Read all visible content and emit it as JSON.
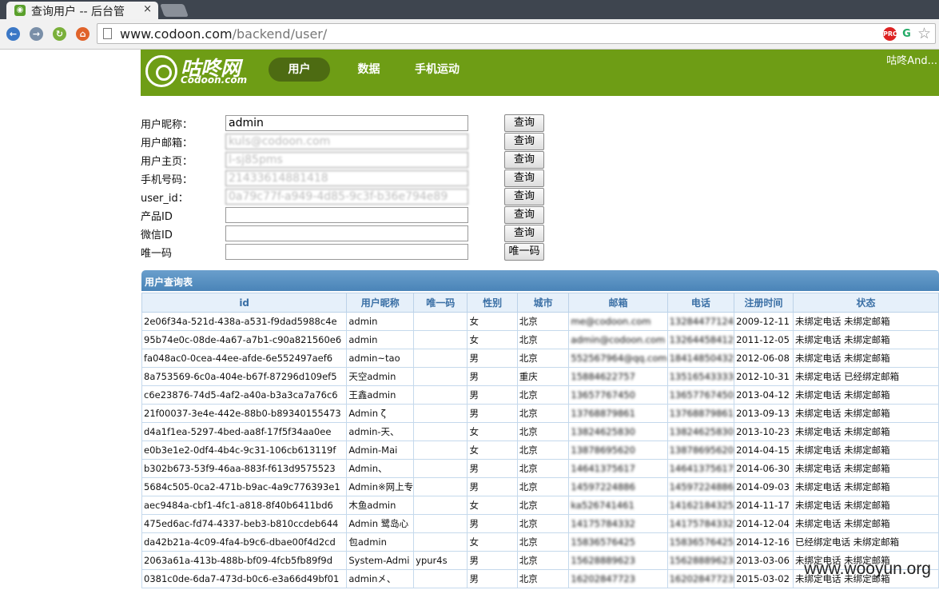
{
  "browser": {
    "tab_title": "查询用户 -- 后台管",
    "tab_close": "×",
    "url_host": "www.codoon.com",
    "url_path": "/backend/user/"
  },
  "site": {
    "logo_cn": "咕咚网",
    "logo_en": "Codoon.com",
    "nav": [
      {
        "label": "用户",
        "active": true
      },
      {
        "label": "数据",
        "active": false
      },
      {
        "label": "手机运动",
        "active": false
      }
    ],
    "account": "咕咚And..."
  },
  "search_form": {
    "rows": [
      {
        "label": "用户昵称：",
        "value": "admin",
        "button": "查询"
      },
      {
        "label": "用户邮箱：",
        "value": "kuls@codoon.com",
        "button": "查询"
      },
      {
        "label": "用户主页：",
        "value": "l-sj85pms",
        "button": "查询"
      },
      {
        "label": "手机号码：",
        "value": "21433614881418",
        "button": "查询"
      },
      {
        "label": "user_id：",
        "value": "0a79c77f-a949-4d85-9c3f-b36e794e89",
        "button": "查询"
      },
      {
        "label": "产品ID",
        "value": "",
        "button": "查询"
      },
      {
        "label": "微信ID",
        "value": "",
        "button": "查询"
      },
      {
        "label": "唯一码",
        "value": "",
        "button": "唯一码"
      }
    ]
  },
  "results": {
    "title": "用户查询表",
    "columns": [
      "id",
      "用户昵称",
      "唯一码",
      "性别",
      "城市",
      "邮箱",
      "电话",
      "注册时间",
      "状态"
    ],
    "rows": [
      [
        "2e06f34a-521d-438a-a531-f9dad5988c4e",
        "admin",
        "",
        "女",
        "北京",
        "me@codoon.com",
        "13284477124",
        "2009-12-11",
        "未绑定电话 未绑定邮箱"
      ],
      [
        "95b74e0c-08de-4a67-a7b1-c90a821560e6",
        "admin",
        "",
        "女",
        "北京",
        "admin@codoon.com",
        "13264458412",
        "2011-12-05",
        "未绑定电话 未绑定邮箱"
      ],
      [
        "fa048ac0-0cea-44ee-afde-6e552497aef6",
        "admin~tao",
        "",
        "男",
        "北京",
        "552567964@qq.com",
        "18414850432",
        "2012-06-08",
        "未绑定电话 未绑定邮箱"
      ],
      [
        "8a753569-6c0a-404e-b67f-87296d109ef5",
        "天空admin",
        "",
        "男",
        "重庆",
        "15884622757",
        "13516543333",
        "2012-10-31",
        "未绑定电话 已经绑定邮箱"
      ],
      [
        "c6e23876-74d5-4af2-a40a-b3a3ca7a76c6",
        "王鑫admin",
        "",
        "男",
        "北京",
        "13657767450",
        "13657767450",
        "2013-04-12",
        "未绑定电话 未绑定邮箱"
      ],
      [
        "21f00037-3e4e-442e-88b0-b89340155473",
        "Admin ζ",
        "",
        "男",
        "北京",
        "13768879861",
        "13768879861",
        "2013-09-13",
        "未绑定电话 未绑定邮箱"
      ],
      [
        "d4a1f1ea-5297-4bed-aa8f-17f5f34aa0ee",
        "admin-天、",
        "",
        "女",
        "北京",
        "13824625830",
        "13824625830",
        "2013-10-23",
        "未绑定电话 未绑定邮箱"
      ],
      [
        "e0b3e1e2-0df4-4b4c-9c31-106cb613119f",
        "Admin-Mai",
        "",
        "女",
        "北京",
        "13878695620",
        "13878695620",
        "2014-04-15",
        "未绑定电话 未绑定邮箱"
      ],
      [
        "b302b673-53f9-46aa-883f-f613d9575523",
        "Admin、",
        "",
        "男",
        "北京",
        "14641375617",
        "14641375617",
        "2014-06-30",
        "未绑定电话 未绑定邮箱"
      ],
      [
        "5684c505-0ca2-471b-b9ac-4a9c776393e1",
        "Admin※网上专",
        "",
        "男",
        "北京",
        "14597224886",
        "14597224886",
        "2014-09-03",
        "未绑定电话 未绑定邮箱"
      ],
      [
        "aec9484a-cbf1-4fc1-a818-8f40b6411bd6",
        "木鱼admin",
        "",
        "女",
        "北京",
        "ka526741461",
        "14162184325",
        "2014-11-17",
        "未绑定电话 未绑定邮箱"
      ],
      [
        "475ed6ac-fd74-4337-beb3-b810ccdeb644",
        "Admin 鹭岛心",
        "",
        "男",
        "北京",
        "14175784332",
        "14175784332",
        "2014-12-04",
        "未绑定电话 未绑定邮箱"
      ],
      [
        "da42b21a-4c09-4fa4-b9c6-dbae00f4d2cd",
        "包admin",
        "",
        "女",
        "北京",
        "15836576425",
        "15836576425",
        "2014-12-16",
        "已经绑定电话 未绑定邮箱"
      ],
      [
        "2063a61a-413b-488b-bf09-4fcb5fb89f9d",
        "System-Admi",
        "ypur4s",
        "男",
        "北京",
        "15628889623",
        "15628889623",
        "2013-03-06",
        "未绑定电话 未绑定邮箱"
      ],
      [
        "0381c0de-6da7-473d-b0c6-e3a66d49bf01",
        "admin㐅、",
        "",
        "男",
        "北京",
        "16202847723",
        "16202847723",
        "2015-03-02",
        "未绑定电话 未绑定邮箱"
      ]
    ]
  },
  "watermark": "www.wooyun.org",
  "colors": {
    "header_green": "#6e9d15",
    "nav_active": "#4d6b12",
    "table_head": "#3a6fa5"
  }
}
